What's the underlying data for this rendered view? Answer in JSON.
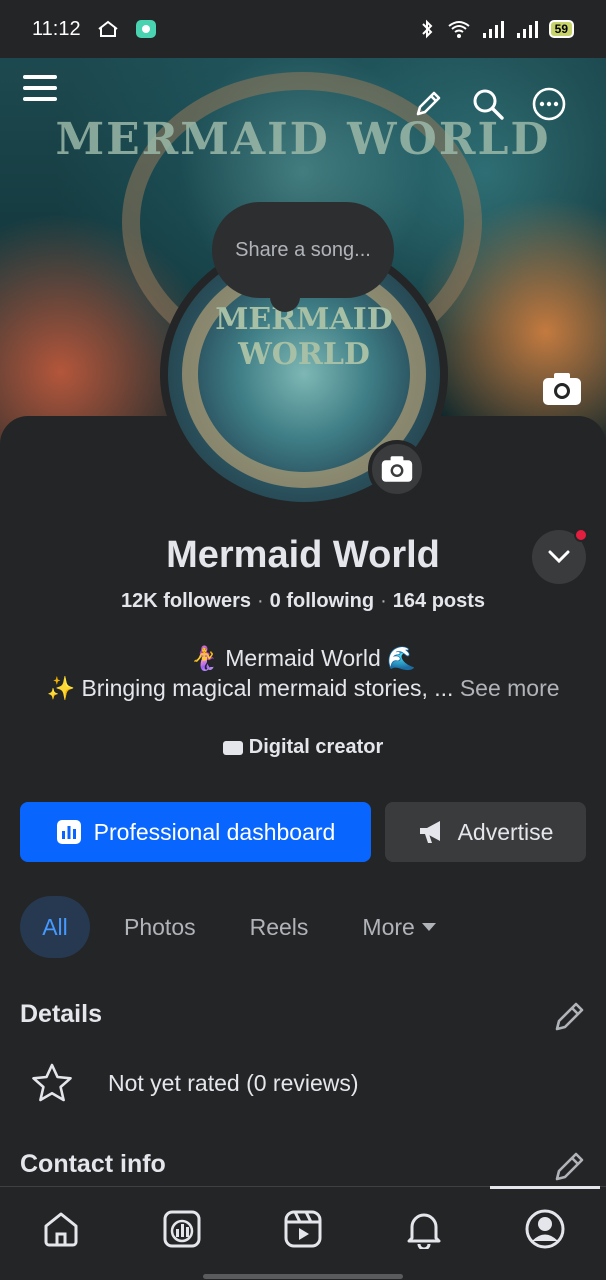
{
  "status_bar": {
    "time": "11:12",
    "battery": "59"
  },
  "header": {
    "icons": [
      "menu-icon",
      "pencil-icon",
      "search-icon",
      "more-icon"
    ]
  },
  "cover": {
    "title_art": "MERMAID WORLD"
  },
  "profile_picture": {
    "title_art": "MERMAID WORLD"
  },
  "song_bubble": {
    "placeholder": "Share a song..."
  },
  "profile": {
    "name": "Mermaid World",
    "followers": "12K followers",
    "following": "0 following",
    "posts": "164 posts",
    "separator": "·",
    "bio_line1": "🧜‍♀️ Mermaid World 🌊",
    "bio_line2": "✨ Bringing magical mermaid stories, ...",
    "see_more": "See more",
    "category": "Digital creator"
  },
  "actions": {
    "dashboard_label": "Professional dashboard",
    "advertise_label": "Advertise"
  },
  "tabs": [
    {
      "label": "All",
      "active": true
    },
    {
      "label": "Photos",
      "active": false
    },
    {
      "label": "Reels",
      "active": false
    },
    {
      "label": "More",
      "active": false
    }
  ],
  "details": {
    "title": "Details",
    "rating": "Not yet rated (0 reviews)"
  },
  "contact": {
    "title": "Contact info"
  },
  "bottom_nav": [
    "home-icon",
    "dashboard-icon",
    "reels-icon",
    "notifications-icon",
    "profile-icon"
  ],
  "colors": {
    "accent": "#0866ff",
    "background": "#242526",
    "active_tab_bg": "#263951",
    "notification": "#e41e3f"
  }
}
